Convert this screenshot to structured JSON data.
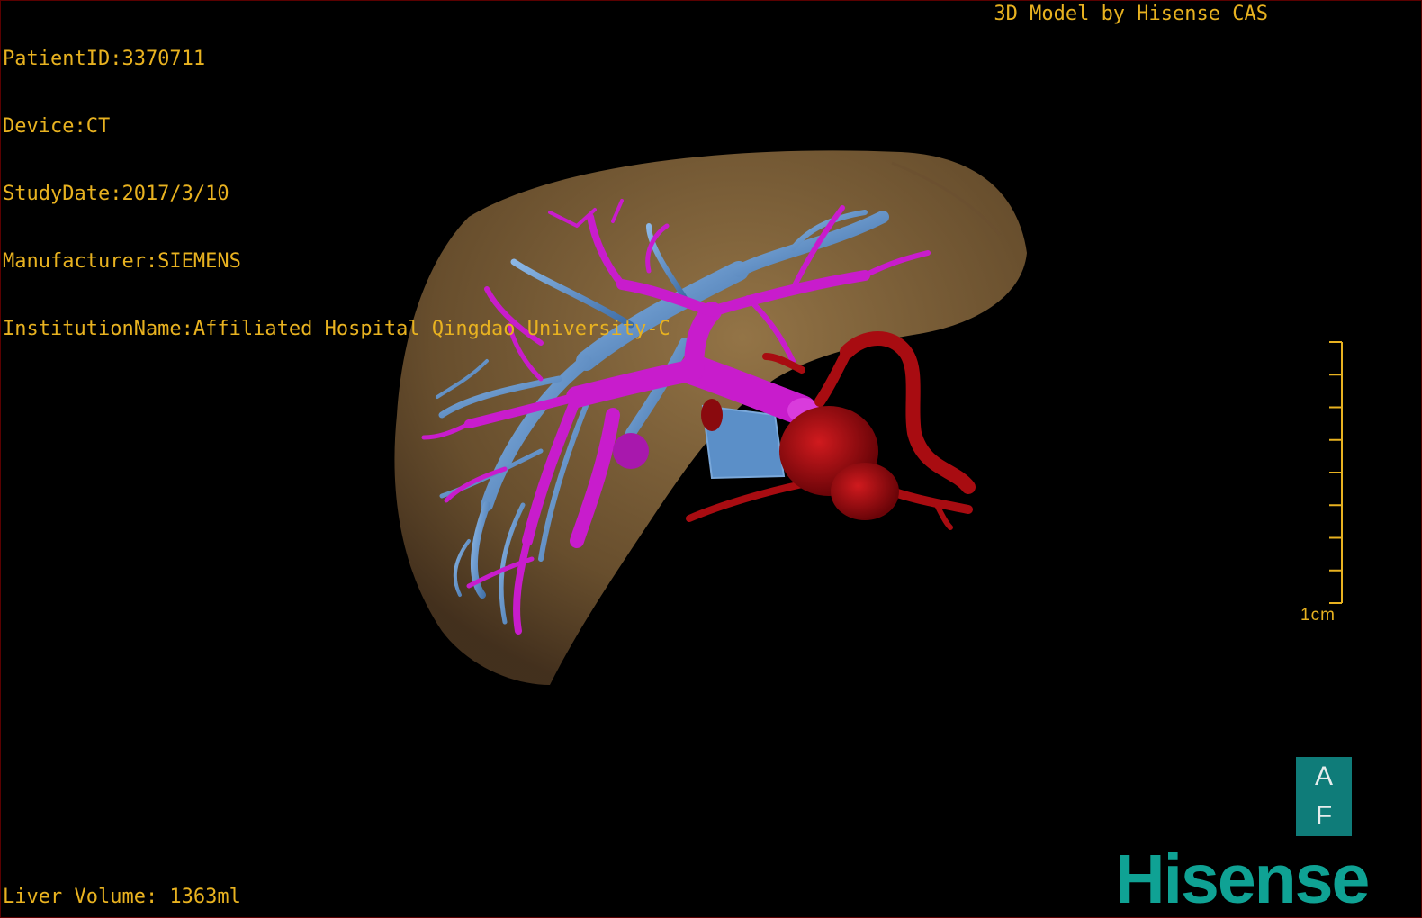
{
  "patient_info": {
    "patient_id": "PatientID:3370711",
    "device": "Device:CT",
    "study_date": "StudyDate:2017/3/10",
    "manufacturer": "Manufacturer:SIEMENS",
    "institution": "InstitutionName:Affiliated Hospital Qingdao University-C"
  },
  "model_credit": "3D Model by Hisense CAS",
  "liver_volume": "Liver Volume: 1363ml",
  "scale": {
    "label": "1cm",
    "tick_count": 9
  },
  "orientation": {
    "top": "A",
    "bottom": "F"
  },
  "brand": "Hisense",
  "colors": {
    "overlay_text": "#e8b220",
    "liver": "#8a6a3e",
    "portal_vein": "#c81ccc",
    "hepatic_vein": "#5b8fc8",
    "artery": "#b00d12",
    "brand": "#0fa294"
  },
  "model_parts": [
    "liver-surface",
    "portal-vein",
    "hepatic-vein",
    "hepatic-artery"
  ]
}
